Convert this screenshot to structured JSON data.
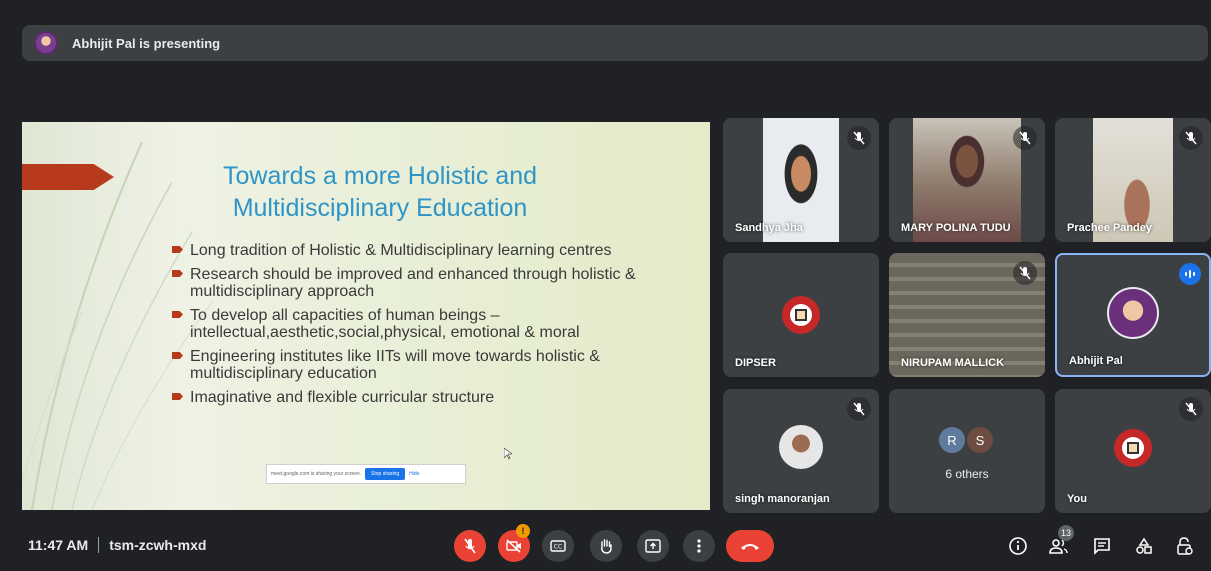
{
  "presenting": {
    "text": "Abhijit Pal is presenting"
  },
  "slide": {
    "title_line1": "Towards a more Holistic and",
    "title_line2": "Multidisciplinary Education",
    "bullets": [
      "Long tradition of Holistic & Multidisciplinary learning centres",
      "Research should be improved and enhanced through holistic & multidisciplinary approach",
      "To develop all capacities of human beings – intellectual,aesthetic,social,physical, emotional & moral",
      "Engineering institutes like IITs will move towards holistic & multidisciplinary education",
      "Imaginative and flexible curricular structure"
    ],
    "share_notice": "meet.google.com is sharing your screen.",
    "share_stop": "Stop sharing",
    "share_hide": "Hide"
  },
  "participants": {
    "p1": "Sandhya Jha",
    "p2": "MARY POLINA TUDU",
    "p3": "Prachee Pandey",
    "p4": "DIPSER",
    "p5": "NIRUPAM MALLICK",
    "p6": "Abhijit Pal",
    "p7": "singh manoranjan",
    "p8_chip1": "R",
    "p8_chip2": "S",
    "p8": "6 others",
    "p9": "You"
  },
  "bottom": {
    "time": "11:47 AM",
    "meeting_code": "tsm-zcwh-mxd",
    "camera_warning": "!",
    "people_count": "13"
  },
  "icons": {
    "mic": "mic-off-icon",
    "camera": "camera-off-icon",
    "captions": "captions-icon",
    "hand": "raise-hand-icon",
    "present": "present-screen-icon",
    "more": "more-options-icon",
    "end": "end-call-icon",
    "info": "info-icon",
    "people": "people-icon",
    "chat": "chat-icon",
    "activities": "activities-icon",
    "host": "host-controls-icon"
  },
  "colors": {
    "accent_red": "#ea4335",
    "accent_blue": "#1a73e8",
    "slide_title": "#2f95c7",
    "slide_accent": "#b83a1c"
  }
}
